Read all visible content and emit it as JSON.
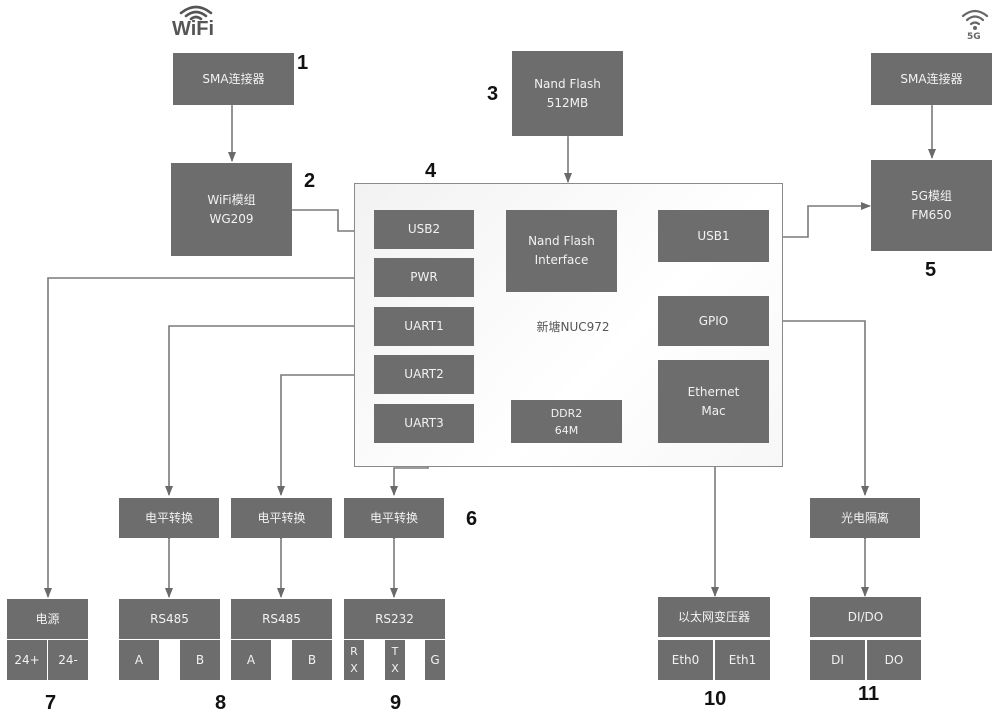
{
  "icons": {
    "wifi_label": "WiFi",
    "g5_label": "5G"
  },
  "numbers": [
    "1",
    "2",
    "3",
    "4",
    "5",
    "6",
    "7",
    "8",
    "9",
    "10",
    "11"
  ],
  "sma_left": "SMA连接器",
  "sma_right": "SMA连接器",
  "wifi_module": {
    "line1": "WiFi模组",
    "line2": "WG209"
  },
  "nand_flash": {
    "line1": "Nand Flash",
    "line2": "512MB"
  },
  "g5_module": {
    "line1": "5G模组",
    "line2": "FM650"
  },
  "soc": {
    "label": "新塘NUC972",
    "usb2": "USB2",
    "pwr": "PWR",
    "uart1": "UART1",
    "uart2": "UART2",
    "uart3": "UART3",
    "nand_if": {
      "line1": "Nand Flash",
      "line2": "Interface"
    },
    "ddr": {
      "line1": "DDR2",
      "line2": "64M"
    },
    "usb1": "USB1",
    "gpio": "GPIO",
    "eth_mac": {
      "line1": "Ethernet",
      "line2": "Mac"
    }
  },
  "level_shift": [
    "电平转换",
    "电平转换",
    "电平转换"
  ],
  "opto": "光电隔离",
  "power": {
    "title": "电源",
    "pins": [
      "24+",
      "24-"
    ]
  },
  "rs485_1": {
    "title": "RS485",
    "pins": [
      "A",
      "B"
    ]
  },
  "rs485_2": {
    "title": "RS485",
    "pins": [
      "A",
      "B"
    ]
  },
  "rs232": {
    "title": "RS232",
    "pins": [
      [
        "R",
        "X"
      ],
      [
        "T",
        "X"
      ],
      [
        "G"
      ]
    ]
  },
  "eth_xfmr": {
    "title": "以太网变压器",
    "pins": [
      "Eth0",
      "Eth1"
    ]
  },
  "dido": {
    "title": "DI/DO",
    "pins": [
      "DI",
      "DO"
    ]
  }
}
